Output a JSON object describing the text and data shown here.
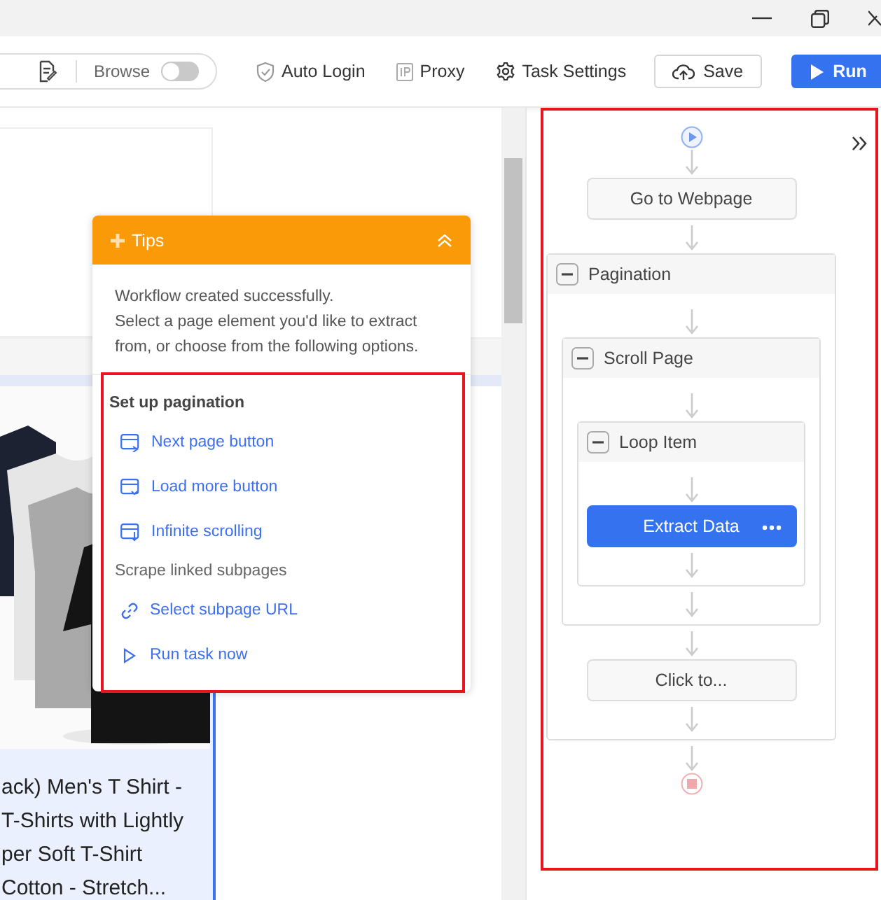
{
  "toolbar": {
    "browse": {
      "label": "Browse",
      "on": false
    },
    "actions": [
      {
        "label": "Auto Login",
        "kind": "shield"
      },
      {
        "label": "Proxy",
        "kind": "ip"
      },
      {
        "label": "Task Settings",
        "kind": "gear"
      }
    ],
    "save": "Save",
    "run": "Run"
  },
  "product": {
    "title_lines": [
      "ack) Men's T Shirt -",
      "T-Shirts with Lightly",
      "per Soft T-Shirt",
      "Cotton - Stretch..."
    ]
  },
  "tips": {
    "title": "Tips",
    "lines": [
      "Workflow created successfully.",
      "Select a page element you'd like to extract from, or choose from the following options."
    ],
    "sections": [
      {
        "heading": "Set up pagination",
        "bold": true,
        "items": [
          {
            "label": "Next page button",
            "kind": "page"
          },
          {
            "label": "Load more button",
            "kind": "more"
          },
          {
            "label": "Infinite scrolling",
            "kind": "scroll"
          }
        ]
      },
      {
        "heading": "Scrape linked subpages",
        "bold": false,
        "items": [
          {
            "label": "Select subpage URL",
            "kind": "link"
          },
          {
            "label": "Run task now",
            "kind": "play"
          }
        ]
      }
    ]
  },
  "workflow": {
    "steps": [
      {
        "kind": "action",
        "label": "Go to Webpage",
        "selected": false
      },
      {
        "kind": "loop",
        "label": "Pagination",
        "expanded": true,
        "children": [
          {
            "kind": "loop",
            "label": "Scroll Page",
            "expanded": true,
            "children": [
              {
                "kind": "loop",
                "label": "Loop Item",
                "expanded": true,
                "children": [
                  {
                    "kind": "action",
                    "label": "Extract Data",
                    "selected": true
                  }
                ]
              }
            ]
          },
          {
            "kind": "action",
            "label": "Click to...",
            "selected": false
          }
        ]
      }
    ]
  }
}
